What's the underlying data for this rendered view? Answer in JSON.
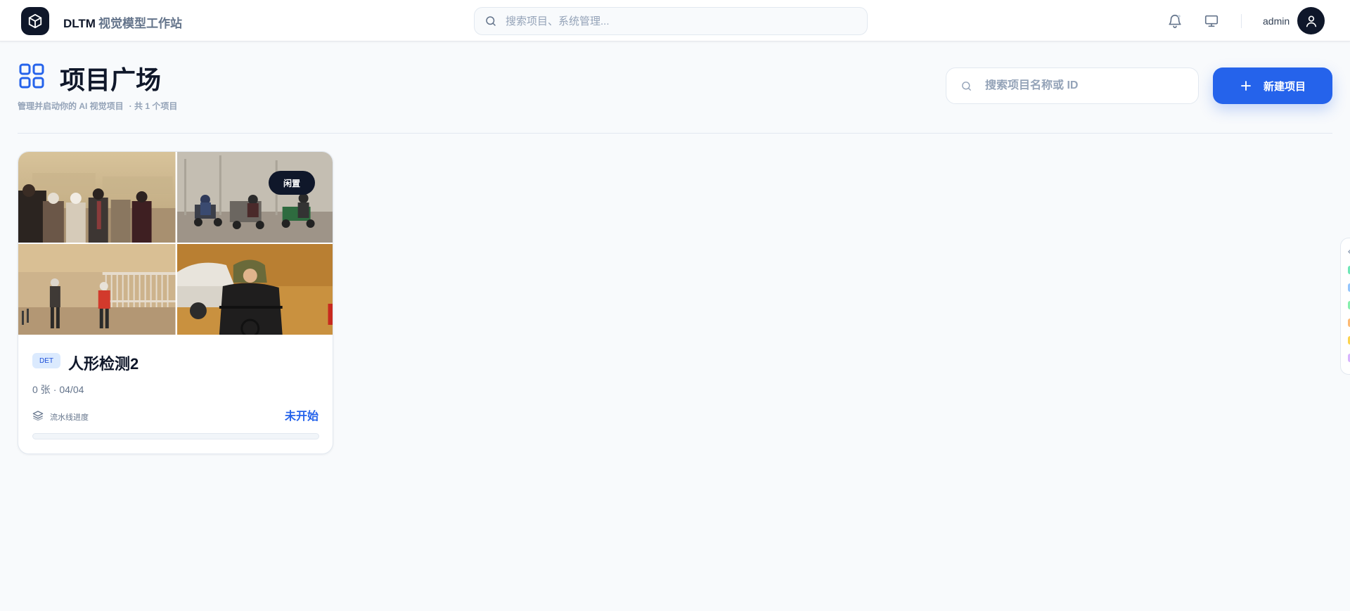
{
  "header": {
    "brand_primary": "DLTM",
    "brand_secondary": "视觉模型工作站",
    "search_placeholder": "搜索项目、系统管理...",
    "username": "admin"
  },
  "page": {
    "title": "项目广场",
    "subtitle": "管理并启动你的 AI 视觉项目",
    "count_text": "· 共 1 个项目",
    "search_placeholder": "搜索项目名称或 ID",
    "new_button_label": "新建项目"
  },
  "projects": [
    {
      "status_badge": "闲置",
      "type": "DET",
      "name": "人形检测2",
      "image_count": "0 张",
      "separator": "·",
      "date": "04/04",
      "progress_label": "流水线进度",
      "progress_status": "未开始",
      "progress_value": 0
    }
  ],
  "colors": {
    "accent": "#2563eb",
    "dark": "#0f172a",
    "muted": "#94a3b8",
    "rail_dots": [
      "#6ee7b7",
      "#93c5fd",
      "#86efac",
      "#fdba74",
      "#fcd34d",
      "#d8b4fe"
    ]
  },
  "icons": {
    "logo": "cube-icon",
    "search": "search-icon",
    "notifications": "bell-icon",
    "display": "monitor-icon",
    "avatar": "user-icon",
    "page": "grid-icon",
    "add": "plus-icon",
    "progress": "layers-icon"
  }
}
